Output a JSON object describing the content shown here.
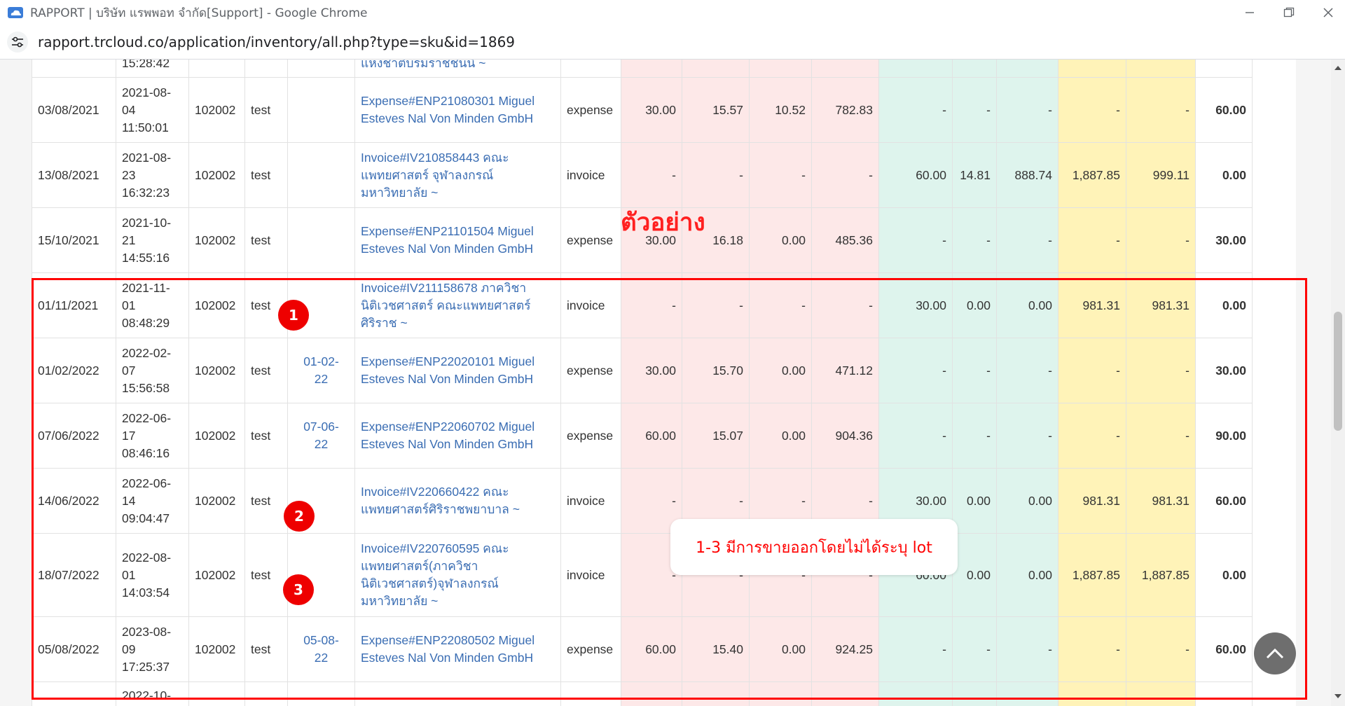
{
  "browser": {
    "window_title": "RAPPORT | บริษัท แรพพอท จำกัด[Support] - Google Chrome",
    "url": "rapport.trcloud.co/application/inventory/all.php?type=sku&id=1869"
  },
  "table": {
    "rows": [
      {
        "date": "",
        "datetime": [
          "15:28:42"
        ],
        "code": "",
        "name": "",
        "lot": [],
        "document": [
          "แห่งชาติบรมราชชนนี ~"
        ],
        "type": "",
        "in_qty": "",
        "in_cost": "",
        "in_unit": "",
        "in_total": "",
        "out_qty": "",
        "out_cost": "",
        "out_unit": "",
        "out_total": "",
        "out_amount": "",
        "balance": "",
        "height": 40
      },
      {
        "date": "03/08/2021",
        "datetime": [
          "2021-08-",
          "04",
          "11:50:01"
        ],
        "code": "102002",
        "name": "test",
        "lot": [],
        "document": [
          "Expense#ENP21080301 Miguel",
          "Esteves Nal Von Minden GmbH"
        ],
        "type": "expense",
        "in_qty": "30.00",
        "in_cost": "15.57",
        "in_unit": "10.52",
        "in_total": "782.83",
        "out_qty": "-",
        "out_cost": "-",
        "out_unit": "-",
        "out_total": "-",
        "out_amount": "-",
        "balance": "60.00",
        "height": 93
      },
      {
        "date": "13/08/2021",
        "datetime": [
          "2021-08-",
          "23",
          "16:32:23"
        ],
        "code": "102002",
        "name": "test",
        "lot": [],
        "document": [
          "Invoice#IV210858443 คณะ",
          "แพทยศาสตร์ จุฬาลงกรณ์",
          "มหาวิทยาลัย ~"
        ],
        "type": "invoice",
        "in_qty": "-",
        "in_cost": "-",
        "in_unit": "-",
        "in_total": "-",
        "out_qty": "60.00",
        "out_cost": "14.81",
        "out_unit": "888.74",
        "out_total": "1,887.85",
        "out_amount": "999.11",
        "balance": "0.00",
        "height": 93
      },
      {
        "date": "15/10/2021",
        "datetime": [
          "2021-10-",
          "21",
          "14:55:16"
        ],
        "code": "102002",
        "name": "test",
        "lot": [],
        "document": [
          "Expense#ENP21101504 Miguel",
          "Esteves Nal Von Minden GmbH"
        ],
        "type": "expense",
        "in_qty": "30.00",
        "in_cost": "16.18",
        "in_unit": "0.00",
        "in_total": "485.36",
        "out_qty": "-",
        "out_cost": "-",
        "out_unit": "-",
        "out_total": "-",
        "out_amount": "-",
        "balance": "30.00",
        "height": 93
      },
      {
        "date": "01/11/2021",
        "datetime": [
          "2021-11-",
          "01",
          "08:48:29"
        ],
        "code": "102002",
        "name": "test",
        "lot": [],
        "document": [
          "Invoice#IV211158678 ภาควิชา",
          "นิติเวชศาสตร์ คณะแพทยศาสตร์",
          "ศิริราช ~"
        ],
        "type": "invoice",
        "in_qty": "-",
        "in_cost": "-",
        "in_unit": "-",
        "in_total": "-",
        "out_qty": "30.00",
        "out_cost": "0.00",
        "out_unit": "0.00",
        "out_total": "981.31",
        "out_amount": "981.31",
        "balance": "0.00",
        "height": 93
      },
      {
        "date": "01/02/2022",
        "datetime": [
          "2022-02-",
          "07",
          "15:56:58"
        ],
        "code": "102002",
        "name": "test",
        "lot": [
          "01-02-",
          "22"
        ],
        "document": [
          "Expense#ENP22020101 Miguel",
          "Esteves Nal Von Minden GmbH"
        ],
        "type": "expense",
        "in_qty": "30.00",
        "in_cost": "15.70",
        "in_unit": "0.00",
        "in_total": "471.12",
        "out_qty": "-",
        "out_cost": "-",
        "out_unit": "-",
        "out_total": "-",
        "out_amount": "-",
        "balance": "30.00",
        "height": 93
      },
      {
        "date": "07/06/2022",
        "datetime": [
          "2022-06-",
          "17",
          "08:46:16"
        ],
        "code": "102002",
        "name": "test",
        "lot": [
          "07-06-",
          "22"
        ],
        "document": [
          "Expense#ENP22060702 Miguel",
          "Esteves Nal Von Minden GmbH"
        ],
        "type": "expense",
        "in_qty": "60.00",
        "in_cost": "15.07",
        "in_unit": "0.00",
        "in_total": "904.36",
        "out_qty": "-",
        "out_cost": "-",
        "out_unit": "-",
        "out_total": "-",
        "out_amount": "-",
        "balance": "90.00",
        "height": 93
      },
      {
        "date": "14/06/2022",
        "datetime": [
          "2022-06-",
          "14",
          "09:04:47"
        ],
        "code": "102002",
        "name": "test",
        "lot": [],
        "document": [
          "Invoice#IV220660422 คณะ",
          "แพทยศาสตร์ศิริราชพยาบาล ~"
        ],
        "type": "invoice",
        "in_qty": "-",
        "in_cost": "-",
        "in_unit": "-",
        "in_total": "-",
        "out_qty": "30.00",
        "out_cost": "0.00",
        "out_unit": "0.00",
        "out_total": "981.31",
        "out_amount": "981.31",
        "balance": "60.00",
        "height": 93
      },
      {
        "date": "18/07/2022",
        "datetime": [
          "2022-08-",
          "01",
          "14:03:54"
        ],
        "code": "102002",
        "name": "test",
        "lot": [],
        "document": [
          "Invoice#IV220760595 คณะ",
          "แพทยศาสตร์(ภาควิชา",
          "นิติเวชศาสตร์)จุฬาลงกรณ์",
          "มหาวิทยาลัย ~"
        ],
        "type": "invoice",
        "in_qty": "-",
        "in_cost": "-",
        "in_unit": "-",
        "in_total": "-",
        "out_qty": "60.00",
        "out_cost": "0.00",
        "out_unit": "0.00",
        "out_total": "1,887.85",
        "out_amount": "1,887.85",
        "balance": "0.00",
        "height": 119
      },
      {
        "date": "05/08/2022",
        "datetime": [
          "2023-08-",
          "09",
          "17:25:37"
        ],
        "code": "102002",
        "name": "test",
        "lot": [
          "05-08-",
          "22"
        ],
        "document": [
          "Expense#ENP22080502 Miguel",
          "Esteves Nal Von Minden GmbH"
        ],
        "type": "expense",
        "in_qty": "60.00",
        "in_cost": "15.40",
        "in_unit": "0.00",
        "in_total": "924.25",
        "out_qty": "-",
        "out_cost": "-",
        "out_unit": "-",
        "out_total": "-",
        "out_amount": "-",
        "balance": "60.00",
        "height": 93
      },
      {
        "date": "",
        "datetime": [
          "2022-10-"
        ],
        "code": "",
        "name": "",
        "lot": [],
        "document": [],
        "type": "",
        "in_qty": "",
        "in_cost": "",
        "in_unit": "",
        "in_total": "",
        "out_qty": "",
        "out_cost": "",
        "out_unit": "",
        "out_total": "",
        "out_amount": "",
        "balance": "",
        "height": 40
      }
    ]
  },
  "annotations": {
    "example_label": "ตัวอย่าง",
    "markers": [
      "1",
      "2",
      "3"
    ],
    "callout": "1-3 มีการขายออกโดยไม่ได้ระบุ lot",
    "color": "#ff0000"
  },
  "icons": {
    "app": "rapport-cloud-icon",
    "tune": "tune-icon",
    "minimize": "minimize-icon",
    "restore": "restore-icon",
    "close": "close-icon",
    "scroll_top": "chevron-up-icon"
  }
}
